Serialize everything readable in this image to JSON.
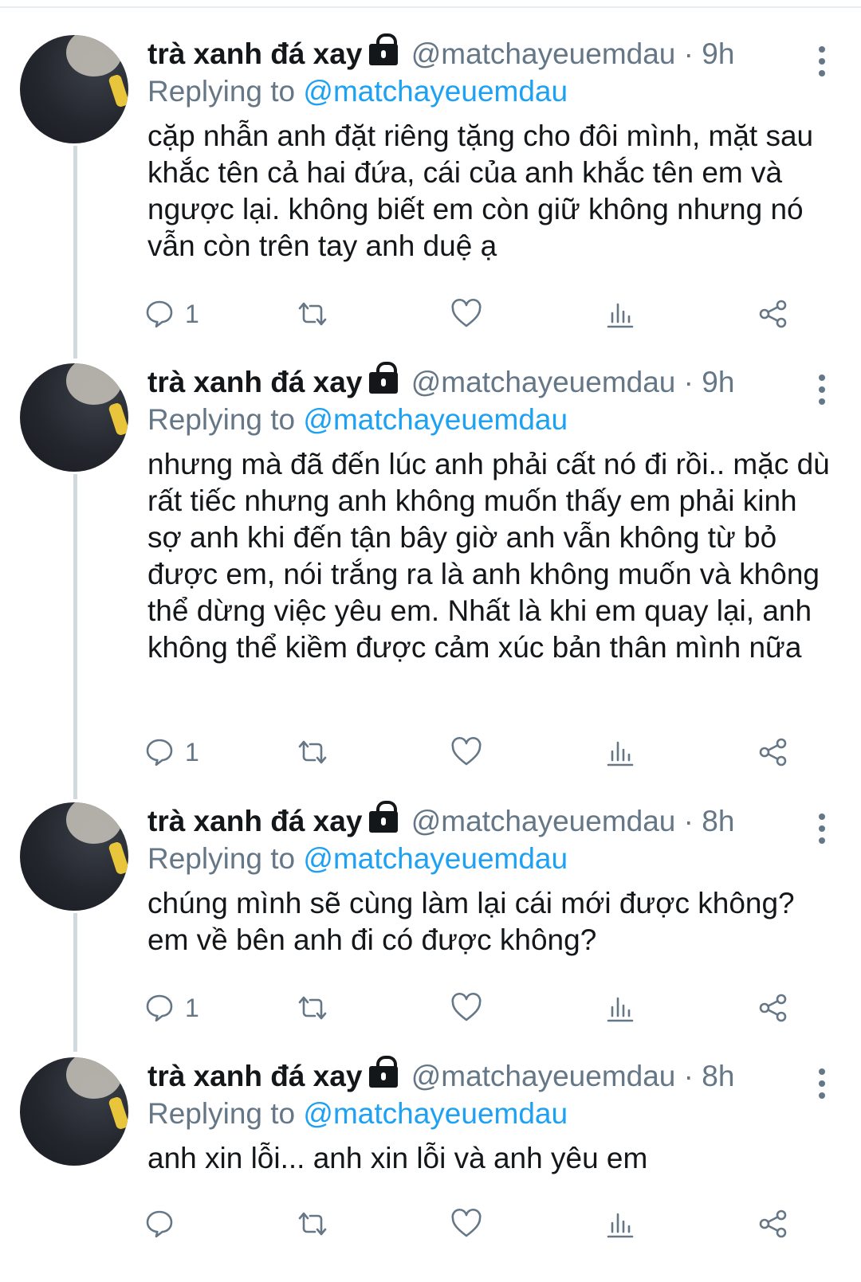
{
  "tweets": [
    {
      "name": "trà xanh đá xay",
      "handle": "@matchayeuemdau",
      "dot": "·",
      "time": "9h",
      "replying_prefix": "Replying to",
      "replying_to": "@matchayeuemdau",
      "text": "cặp nhẫn anh đặt riêng tặng cho đôi mình, mặt sau khắc tên cả hai đứa, cái của anh khắc tên em và ngược lại. không biết em còn giữ không nhưng nó vẫn còn trên tay anh duệ ạ",
      "reply_count": "1"
    },
    {
      "name": "trà xanh đá xay",
      "handle": "@matchayeuemdau",
      "dot": "·",
      "time": "9h",
      "replying_prefix": "Replying to",
      "replying_to": "@matchayeuemdau",
      "text": "nhưng mà đã đến lúc anh phải cất nó đi rồi.. mặc dù rất tiếc nhưng anh không muốn thấy em phải kinh sợ anh khi đến tận bây giờ anh vẫn không từ bỏ được em, nói trắng ra là anh không muốn và không thể dừng việc yêu em. Nhất là khi em quay lại, anh không thể kiềm được cảm xúc bản thân mình nữa",
      "reply_count": "1"
    },
    {
      "name": "trà xanh đá xay",
      "handle": "@matchayeuemdau",
      "dot": "·",
      "time": "8h",
      "replying_prefix": "Replying to",
      "replying_to": "@matchayeuemdau",
      "text": "chúng mình sẽ cùng làm lại cái mới được không? em về bên anh đi có được không?",
      "reply_count": "1"
    },
    {
      "name": "trà xanh đá xay",
      "handle": "@matchayeuemdau",
      "dot": "·",
      "time": "8h",
      "replying_prefix": "Replying to",
      "replying_to": "@matchayeuemdau",
      "text": "anh xin lỗi... anh xin lỗi và anh yêu em",
      "reply_count": ""
    }
  ],
  "icons": [
    "lock-icon",
    "more-icon",
    "reply-icon",
    "retweet-icon",
    "like-icon",
    "analytics-icon",
    "share-icon"
  ],
  "colors": {
    "name": "#14171a",
    "muted": "#657786",
    "link": "#1da1f2",
    "thread_line": "#cfd9de"
  }
}
